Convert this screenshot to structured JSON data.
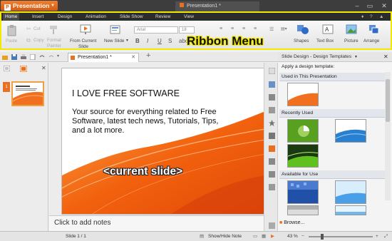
{
  "app": {
    "button_label": "Presentation",
    "doc_title": "Presentation1 *"
  },
  "menu": [
    {
      "label": "Home"
    },
    {
      "label": "Insert"
    },
    {
      "label": "Design"
    },
    {
      "label": "Animation"
    },
    {
      "label": "Slide Show"
    },
    {
      "label": "Review"
    },
    {
      "label": "View"
    }
  ],
  "ribbon": {
    "callout": "Ribbon Menu",
    "paste": "Paste",
    "cut": "Cut",
    "copy": "Copy",
    "format": "Format",
    "painter": "Painter",
    "from_current": "From Current",
    "slide_cut": "Slide",
    "new_slide": "New Slide",
    "font_name": "Arial",
    "font_size": "18",
    "shapes": "Shapes",
    "text_box": "Text Box",
    "picture": "Picture",
    "arrange": "Arrange"
  },
  "tabs": {
    "slide_tab": "Presentation1 *"
  },
  "slide": {
    "title": "I LOVE FREE SOFTWARE",
    "body": "Your source for everything related to Free Software, latest tech news, Tutorials, Tips, and a lot more.",
    "callout": "<current slide>"
  },
  "thumbnail": {
    "number": "1"
  },
  "notes": {
    "placeholder": "Click to add notes"
  },
  "taskpane": {
    "title": "Slide Design - Design Templates",
    "apply_label": "Apply a design template:",
    "sections": [
      "Used in This Presentation",
      "Recently Used",
      "Available for Use"
    ],
    "browse": "Browse..."
  },
  "status": {
    "slide": "Slide 1 / 1",
    "show_hide": "Show/Hide Note",
    "zoom": "43 %"
  },
  "colors": {
    "accent": "#e87020",
    "highlight": "#f2e800"
  }
}
